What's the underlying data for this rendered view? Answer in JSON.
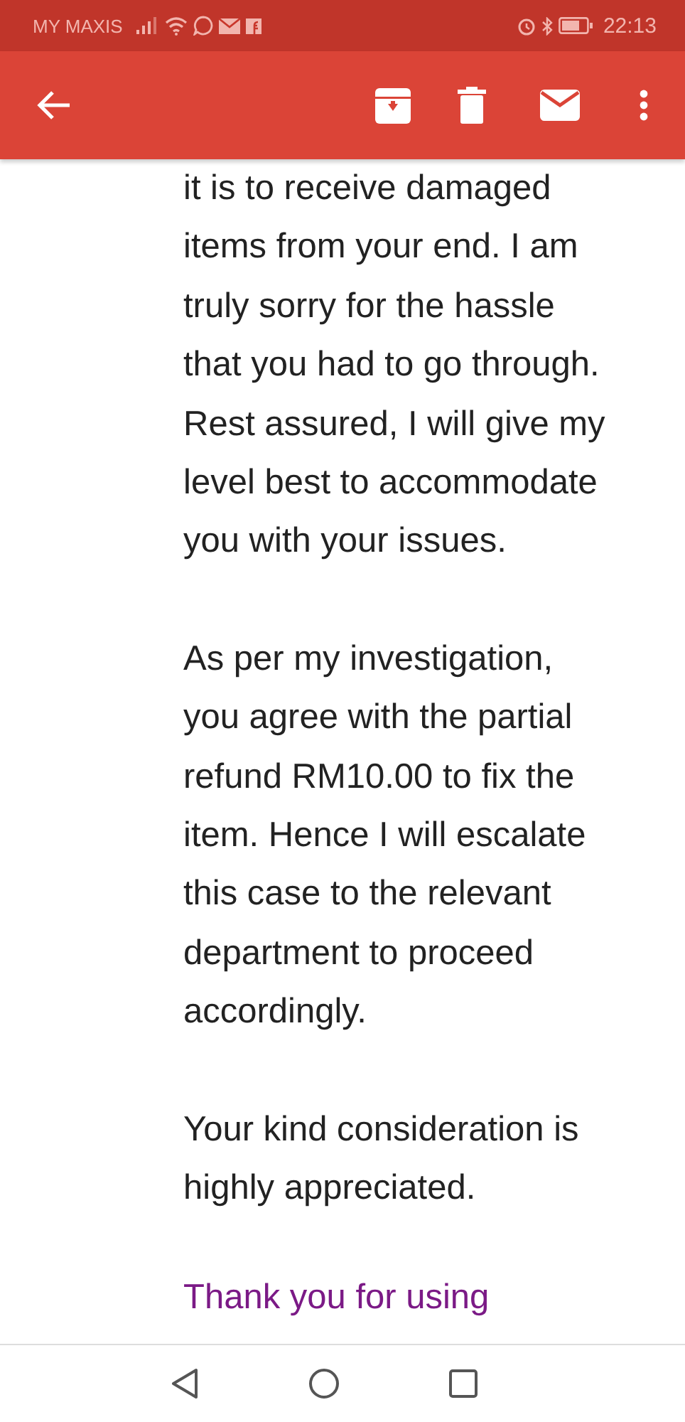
{
  "status_bar": {
    "carrier": "MY MAXIS",
    "time": "22:13"
  },
  "message": {
    "paragraphs": [
      {
        "lines": [
          "it is to receive damaged",
          "items from your end. I am",
          "truly sorry for the hassle",
          "that you had to go through.",
          "Rest assured, I will give my",
          "level best to accommodate",
          "you with your issues."
        ]
      },
      {
        "lines": [
          "As per my investigation,",
          "you agree with the partial",
          "refund RM10.00 to fix the",
          "item. Hence I will escalate",
          "this case to the relevant",
          "department to proceed",
          "accordingly."
        ]
      },
      {
        "lines": [
          "Your kind consideration is",
          "highly appreciated."
        ]
      }
    ],
    "closing": "Thank you for using"
  }
}
